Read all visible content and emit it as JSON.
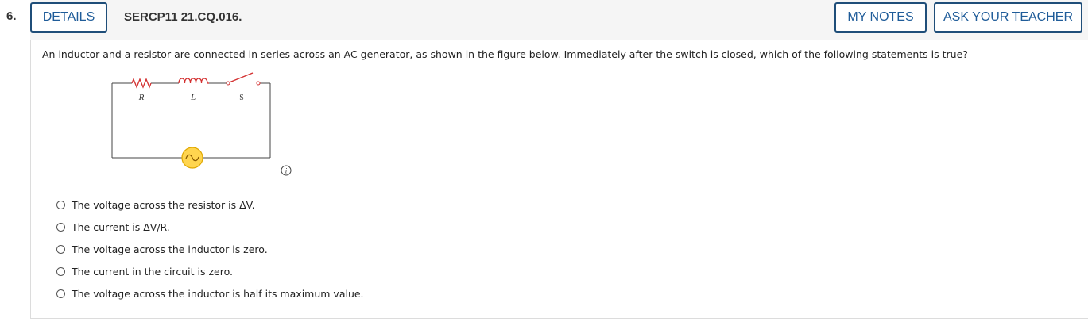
{
  "question": {
    "number": "6.",
    "details_label": "DETAILS",
    "id": "SERCP11 21.CQ.016.",
    "my_notes_label": "MY NOTES",
    "ask_teacher_label": "ASK YOUR TEACHER",
    "prompt": "An inductor and a resistor are connected in series across an AC generator, as shown in the figure below. Immediately after the switch is closed, which of the following statements is true?"
  },
  "figure": {
    "labels": {
      "resistor": "R",
      "inductor": "L",
      "switch": "S"
    },
    "colors": {
      "components": "#d32f2f",
      "wire": "#444444",
      "source_fill": "#ffd54f",
      "source_stroke": "#e0a800"
    }
  },
  "choices": [
    {
      "label": "The voltage across the resistor is ΔV."
    },
    {
      "label": "The current is ΔV/R."
    },
    {
      "label": "The voltage across the inductor is zero."
    },
    {
      "label": "The current in the circuit is zero."
    },
    {
      "label": "The voltage across the inductor is half its maximum value."
    }
  ],
  "icons": {
    "info": "info-icon"
  },
  "colors": {
    "button_border": "#1f4e79",
    "button_text": "#1f5c99",
    "header_bg": "#f5f5f5"
  }
}
